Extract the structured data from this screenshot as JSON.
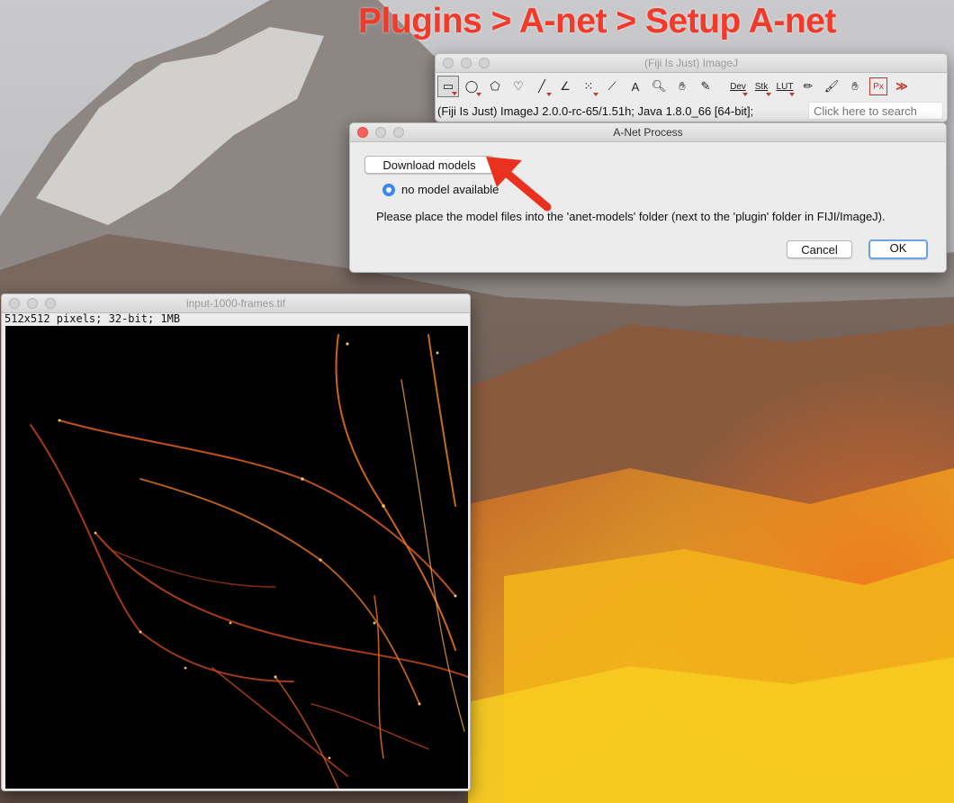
{
  "annotation": {
    "title": "Plugins > A-net > Setup A-net"
  },
  "imagej_window": {
    "title": "(Fiji Is Just) ImageJ",
    "tools": [
      {
        "name": "rectangle-tool-icon",
        "glyph": "▭"
      },
      {
        "name": "oval-tool-icon",
        "glyph": "◯"
      },
      {
        "name": "polygon-tool-icon",
        "glyph": "⬠"
      },
      {
        "name": "freehand-tool-icon",
        "glyph": "♡"
      },
      {
        "name": "line-tool-icon",
        "glyph": "╱"
      },
      {
        "name": "angle-tool-icon",
        "glyph": "∠"
      },
      {
        "name": "multipoint-tool-icon",
        "glyph": "⁙"
      },
      {
        "name": "wand-tool-icon",
        "glyph": "⟋"
      },
      {
        "name": "text-tool-icon",
        "glyph": "A"
      },
      {
        "name": "magnifier-tool-icon",
        "glyph": "🔍︎"
      },
      {
        "name": "hand-tool-icon",
        "glyph": "✋︎"
      },
      {
        "name": "color-picker-tool-icon",
        "glyph": "✎"
      }
    ],
    "menu_tools": [
      "Dev",
      "Stk",
      "LUT"
    ],
    "extra_tools": [
      {
        "name": "pencil-tool-icon",
        "glyph": "✏︎"
      },
      {
        "name": "brush-tool-icon",
        "glyph": "🖌︎"
      },
      {
        "name": "flood-fill-tool-icon",
        "glyph": "✋︎"
      }
    ],
    "px_tool": "Px",
    "more_tools": "≫",
    "status": "(Fiji Is Just) ImageJ 2.0.0-rc-65/1.51h; Java 1.8.0_66 [64-bit];",
    "search_placeholder": "Click here to search"
  },
  "anet_dialog": {
    "title": "A-Net Process",
    "download_button": "Download models",
    "radio_label": "no model available",
    "info": "Please place the model files into the 'anet-models' folder (next to the 'plugin' folder in FIJI/ImageJ).",
    "cancel_button": "Cancel",
    "ok_button": "OK"
  },
  "image_window": {
    "title": "input-1000-frames.tif",
    "info": "512x512 pixels; 32-bit; 1MB"
  },
  "colors": {
    "annotation_red": "#f23a2a",
    "default_button_border": "#6aa2ee",
    "radio_blue": "#3d87e8"
  }
}
